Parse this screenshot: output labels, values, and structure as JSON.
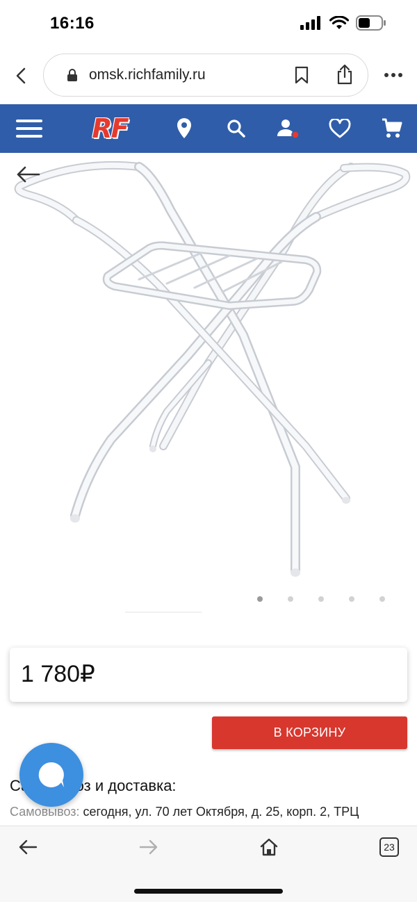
{
  "status_bar": {
    "time": "16:16"
  },
  "browser": {
    "url": "omsk.richfamily.ru",
    "tabs_count": "23"
  },
  "site_nav": {
    "logo": "RF",
    "accent_color": "#2f5da9",
    "logo_color": "#e63a2e",
    "items": [
      "menu-icon",
      "location-icon",
      "search-icon",
      "user-icon",
      "heart-icon",
      "cart-icon"
    ]
  },
  "product": {
    "image_count": 5,
    "active_image": 1,
    "price": "1 780₽",
    "add_to_cart_label": "В КОРЗИНУ",
    "button_color": "#d8372e"
  },
  "delivery": {
    "title": "Самовывоз и доставка:",
    "pickup_label": "Самовывоз:",
    "pickup_value": " сегодня, ул. 70 лет Октября, д. 25, корп. 2, ТРЦ"
  }
}
